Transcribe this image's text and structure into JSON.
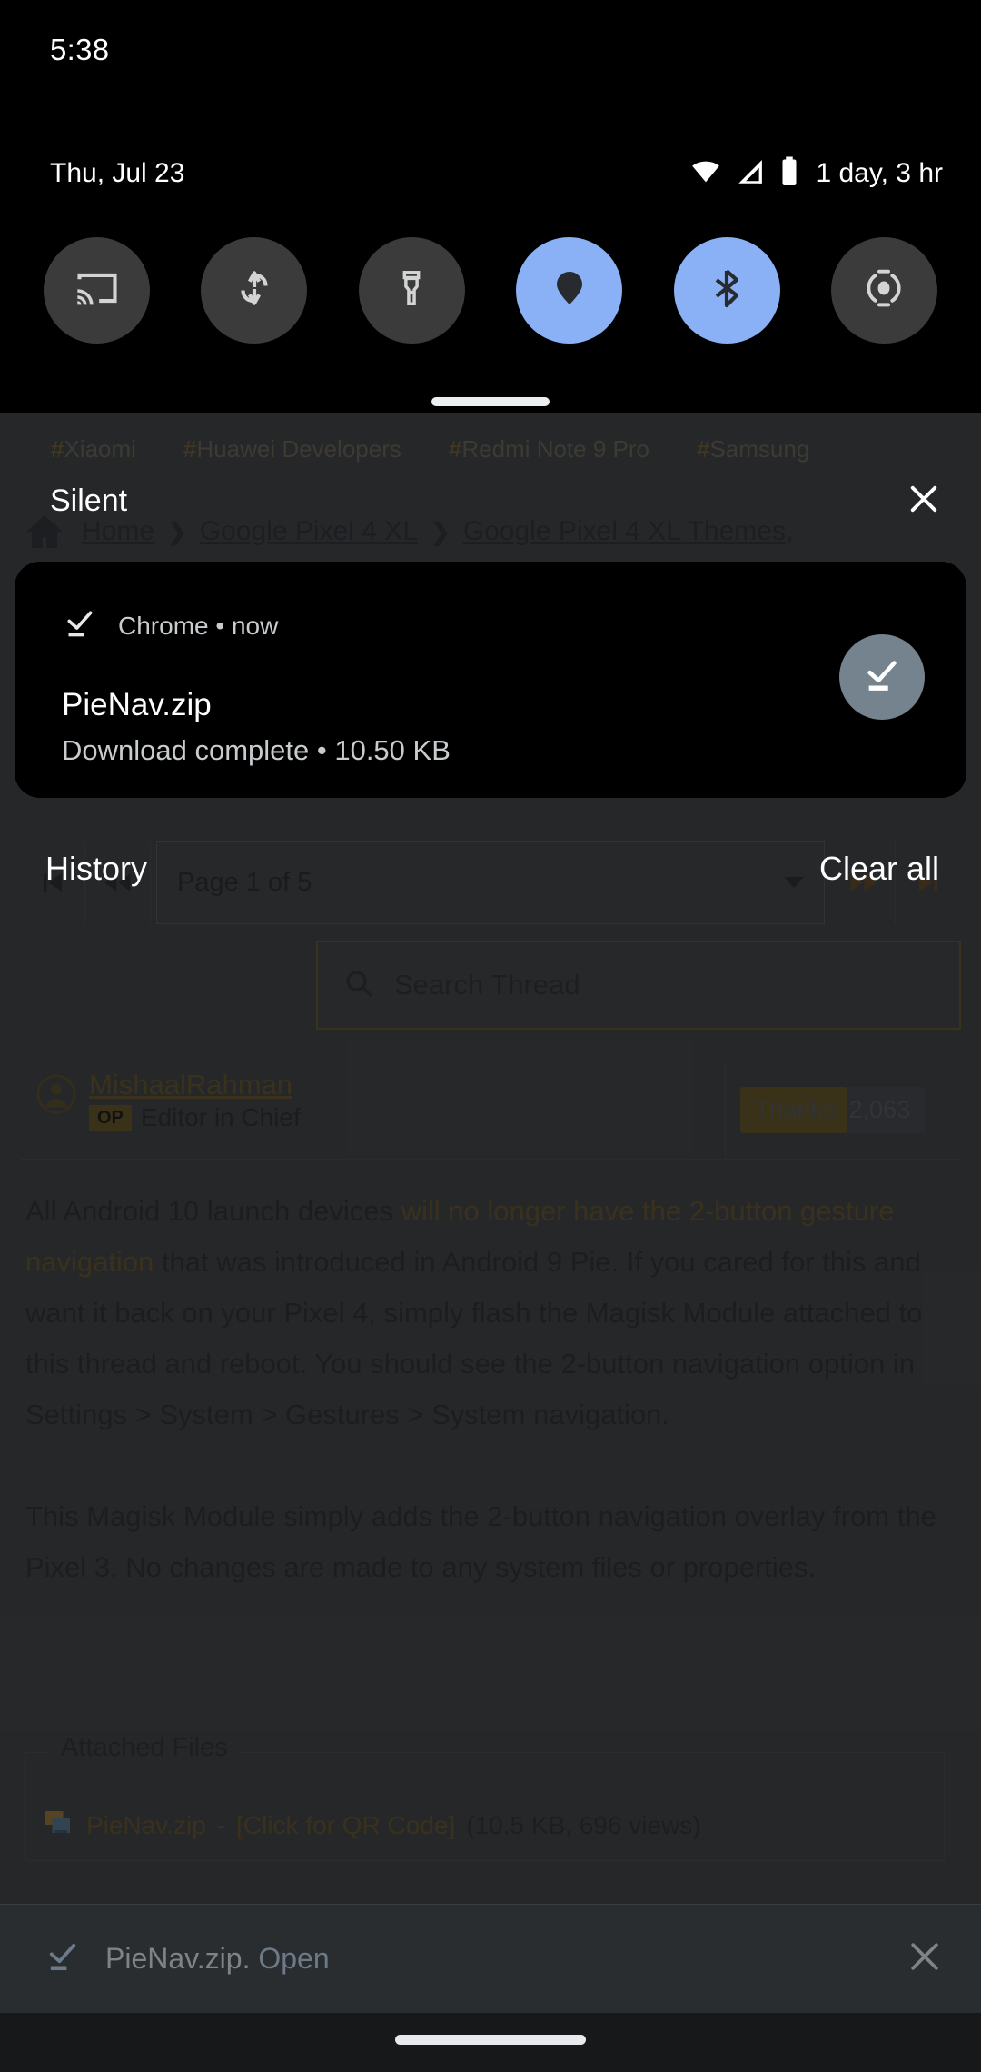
{
  "status_bar": {
    "time": "5:38"
  },
  "quick_settings": {
    "date": "Thu, Jul 23",
    "battery_estimate": "1 day, 3 hr",
    "icons": [
      "wifi-icon",
      "signal-icon",
      "battery-icon"
    ],
    "active_color": "#8ab0f5",
    "inactive_color": "#3b3b3b",
    "tiles": [
      {
        "name": "cast-tile",
        "icon": "cast-icon",
        "active": false
      },
      {
        "name": "auto-rotate-tile",
        "icon": "auto-rotate-icon",
        "active": false
      },
      {
        "name": "flashlight-tile",
        "icon": "flashlight-icon",
        "active": false
      },
      {
        "name": "location-tile",
        "icon": "location-icon",
        "active": true
      },
      {
        "name": "bluetooth-tile",
        "icon": "bluetooth-icon",
        "active": true
      },
      {
        "name": "nfc-tile",
        "icon": "nfc-icon",
        "active": false
      }
    ]
  },
  "shade": {
    "section_label": "Silent",
    "close_icon": "close-icon",
    "history_label": "History",
    "clear_all_label": "Clear all"
  },
  "notification": {
    "app_name": "Chrome",
    "separator": "•",
    "time": "now",
    "app_icon": "download-done-icon",
    "title": "PieNav.zip",
    "subtitle": "Download complete • 10.50 KB",
    "badge_icon": "download-done-icon",
    "badge_color": "#74838d"
  },
  "webpage": {
    "hashtags": [
      {
        "hash": "#",
        "label": "Xiaomi"
      },
      {
        "hash": "#",
        "label": "Huawei Developers"
      },
      {
        "hash": "#",
        "label": "Redmi Note 9 Pro"
      },
      {
        "hash": "#",
        "label": "Samsung"
      }
    ],
    "breadcrumb": {
      "home_icon": "home-icon",
      "separator": "❯",
      "items": [
        "Home",
        "Google Pixel 4 XL",
        "Google Pixel 4 XL Themes,"
      ]
    },
    "pagination": {
      "first_icon": "skip-previous-icon",
      "prev_icon": "previous-icon",
      "page_label": "Page 1 of 5",
      "next_icon": "next-icon",
      "last_icon": "skip-next-icon",
      "caret_icon": "chevron-down-icon"
    },
    "search": {
      "icon": "search-icon",
      "placeholder": "Search Thread"
    },
    "post": {
      "avatar_icon": "avatar-icon",
      "username": "MishaalRahman",
      "op_badge": "OP",
      "user_title": "Editor in Chief",
      "thanks": "Thanks: 2,063",
      "paragraph1_pre": "All Android 10 launch devices ",
      "paragraph1_link": "will no longer have the 2-button gesture navigation",
      "paragraph1_post": " that was introduced in Android 9 Pie. If you cared for this and want it back on your Pixel 4, simply flash the Magisk Module attached to this thread and reboot. You should see the 2-button navigation option in Settings > System > Gestures > System navigation.",
      "paragraph2": "This Magisk Module simply adds the 2-button navigation overlay from the Pixel 3. No changes are made to any system files or properties."
    },
    "attachments": {
      "legend": "Attached Files",
      "file_icon": "zip-file-icon",
      "file_name": "PieNav.zip",
      "dash": " - ",
      "qr_label": "[Click for QR Code]",
      "meta": " (10.5 KB, 696 views)"
    }
  },
  "download_bar": {
    "icon": "download-done-icon",
    "file_text": "PieNav.zip.",
    "open_label": "Open",
    "close_icon": "close-icon"
  },
  "nav_bar": {
    "gesture_pill": "gesture-pill"
  }
}
